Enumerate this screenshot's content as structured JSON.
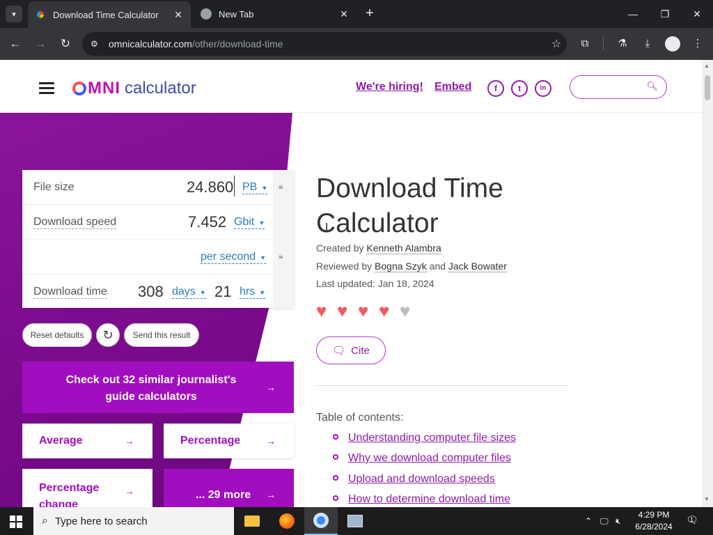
{
  "browser": {
    "tabs": [
      {
        "title": "Download Time Calculator",
        "active": true
      },
      {
        "title": "New Tab",
        "active": false
      }
    ],
    "url_host": "omnicalculator.com",
    "url_path": "/other/download-time"
  },
  "header": {
    "logo_omni": "MNI",
    "logo_calc": "calculator",
    "hiring_link": "We're hiring!",
    "embed_link": "Embed",
    "social": [
      "f",
      "t",
      "in"
    ]
  },
  "calculator": {
    "file_size": {
      "label": "File size",
      "value": "24.860",
      "unit": "PB"
    },
    "download_speed": {
      "label": "Download speed",
      "value": "7.452",
      "unit": "Gbit",
      "per": "per second"
    },
    "download_time": {
      "label": "Download time",
      "days_value": "308",
      "days_unit": "days",
      "hrs_value": "21",
      "hrs_unit": "hrs"
    },
    "reset_label": "Reset defaults",
    "send_label": "Send this result"
  },
  "promo": {
    "cta": "Check out 32 similar journalist's guide calculators",
    "tiles": [
      "Average",
      "Percentage",
      "Percentage change",
      "... 29 more"
    ]
  },
  "article": {
    "title": "Download Time Calculator",
    "created_prefix": "Created by",
    "created_by": "Kenneth Alambra",
    "reviewed_prefix": "Reviewed by",
    "reviewer1": "Bogna Szyk",
    "and": "and",
    "reviewer2": "Jack Bowater",
    "updated": "Last updated: Jan 18, 2024",
    "rating": 4.5,
    "cite_label": "Cite",
    "toc_title": "Table of contents:",
    "toc": [
      "Understanding computer file sizes",
      "Why we download computer files",
      "Upload and download speeds",
      "How to determine download time"
    ]
  },
  "taskbar": {
    "search_placeholder": "Type here to search",
    "time": "4:29 PM",
    "date": "6/28/2024",
    "notifications": "1"
  }
}
